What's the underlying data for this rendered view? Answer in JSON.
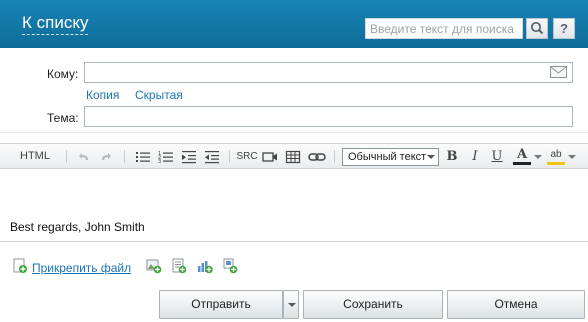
{
  "header": {
    "title": "К списку",
    "search_placeholder": "Введите текст для поиска",
    "help_label": "?"
  },
  "form": {
    "to_label": "Кому:",
    "to_value": "",
    "cc_link": "Копия",
    "bcc_link": "Скрытая",
    "subject_label": "Тема:",
    "subject_value": ""
  },
  "toolbar": {
    "html_label": "HTML",
    "src_label": "SRC",
    "style_value": "Обычный текст",
    "bold_label": "B",
    "italic_label": "I",
    "underline_label": "U",
    "font_color_label": "A",
    "highlight_label": "ab",
    "font_color": "#222222",
    "highlight_color": "#f0c419"
  },
  "editor": {
    "body_text": "Best regards, John Smith"
  },
  "attachments": {
    "attach_label": "Прикрепить файл"
  },
  "actions": {
    "send_label": "Отправить",
    "save_label": "Сохранить",
    "cancel_label": "Отмена"
  },
  "colors": {
    "header_bg": "#1278a8",
    "link": "#1a74b8"
  }
}
